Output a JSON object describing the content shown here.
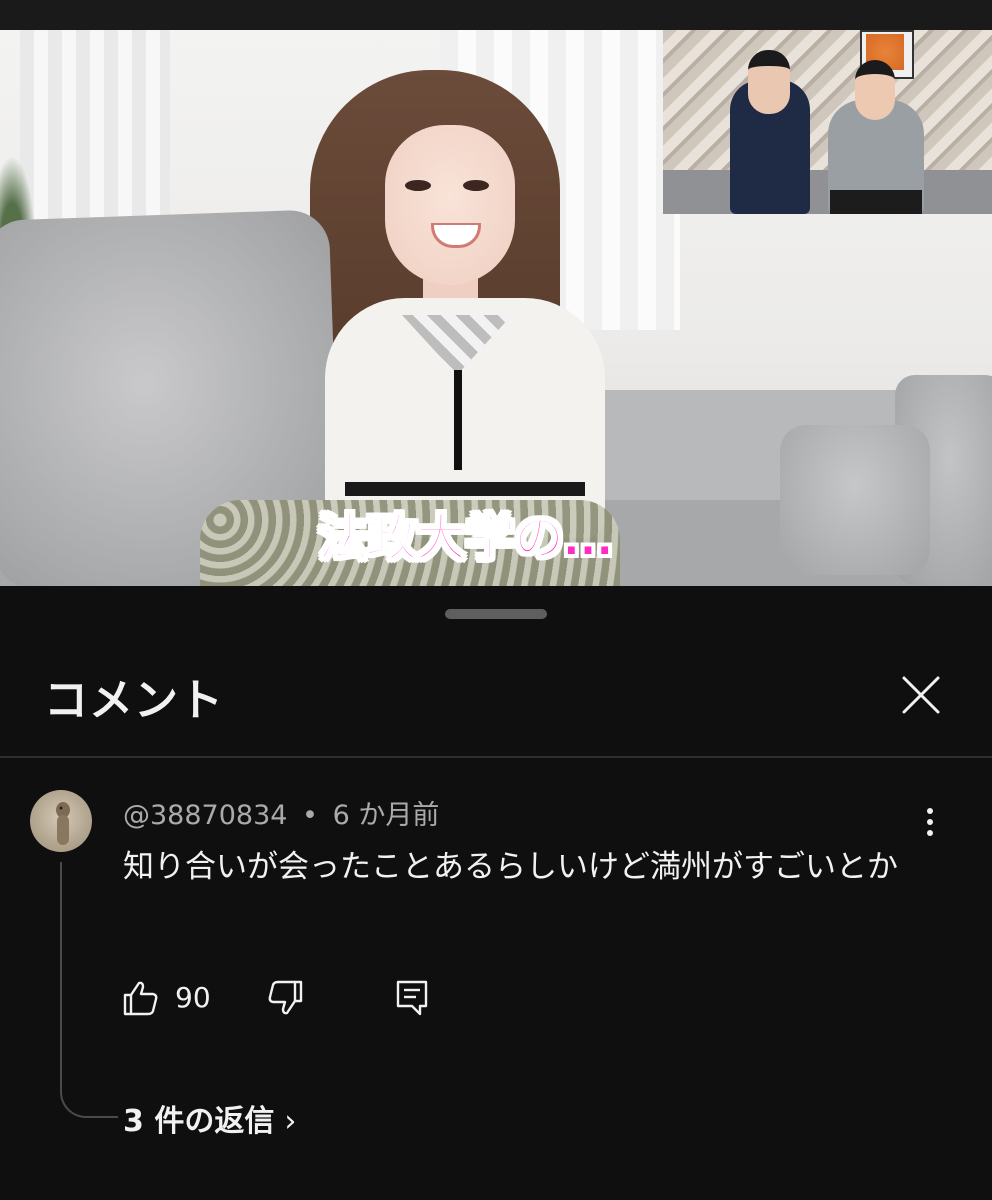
{
  "video": {
    "caption": "法政大学の…"
  },
  "sheet": {
    "title": "コメント"
  },
  "comment": {
    "author": "@38870834",
    "separator": "•",
    "time": "6 か月前",
    "text": "知り合いが会ったことあるらしいけど満州がすごいとか",
    "likes": "90",
    "replies_label": "3 件の返信",
    "replies_chevron": "›"
  },
  "icons": {
    "close": "close-icon",
    "more": "more-vertical-icon",
    "like": "thumb-up-icon",
    "dislike": "thumb-down-icon",
    "reply": "reply-icon"
  },
  "colors": {
    "background": "#0f0f0f",
    "text_primary": "#f1f1f1",
    "text_secondary": "#aaaaaa",
    "caption_pink": "#ff2bc2"
  }
}
